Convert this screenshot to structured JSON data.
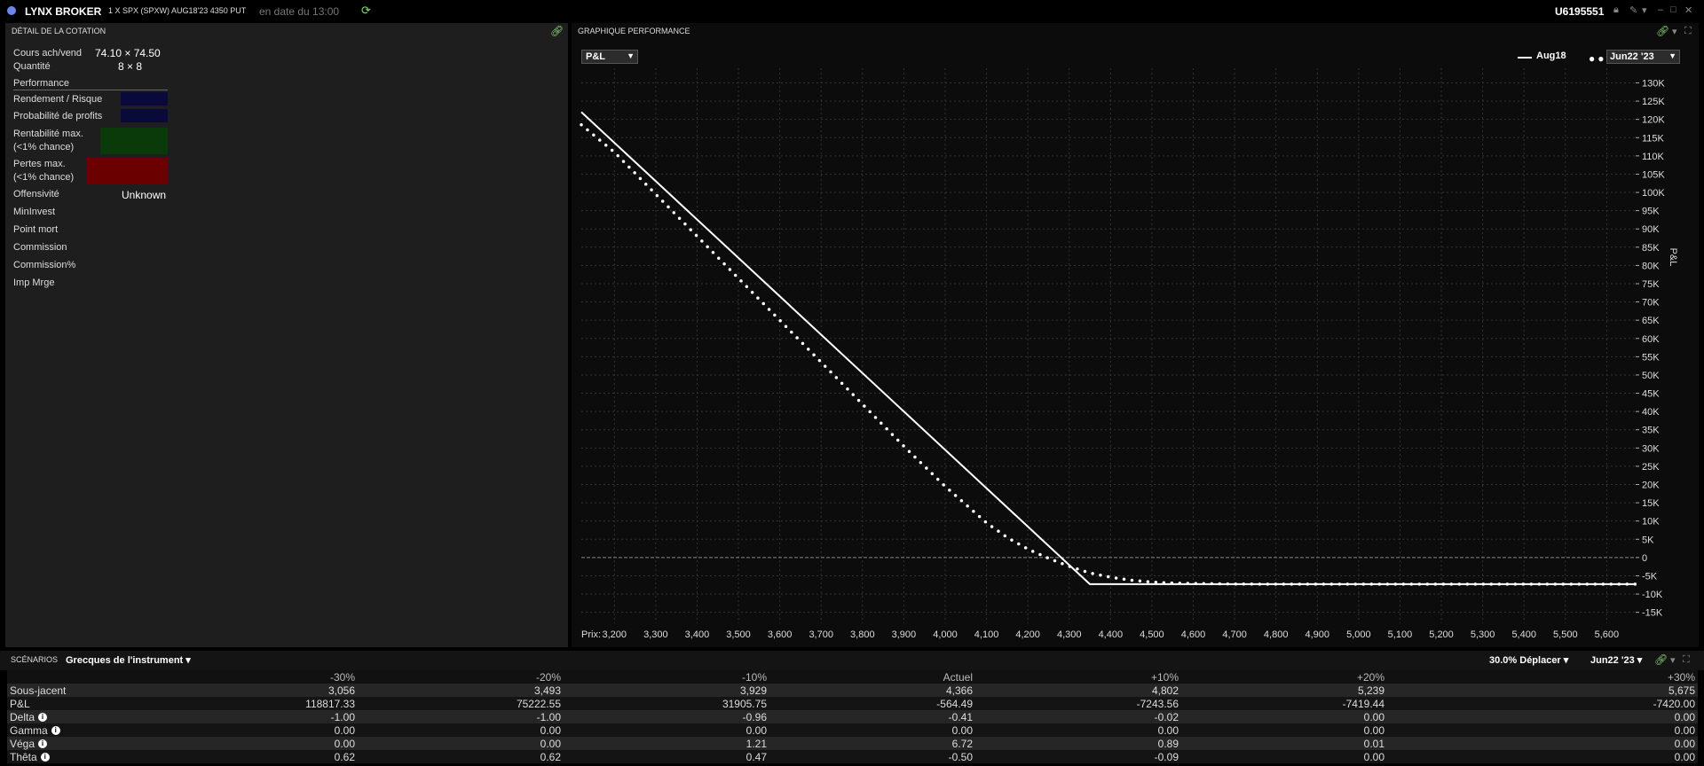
{
  "titlebar": {
    "app_name": "LYNX BROKER",
    "contract": "1 X SPX (SPXW) AUG18'23 4350 PUT",
    "as_of": "en date du 13:00",
    "account": "U6195551"
  },
  "quote_panel": {
    "title": "DÉTAIL DE LA COTATION",
    "bid_ask_label": "Cours ach/vend",
    "bid_ask_value": "74.10 × 74.50",
    "quantity_label": "Quantité",
    "quantity_value": "8 × 8",
    "performance_label": "Performance",
    "rows": [
      {
        "label": "Rendement / Risque"
      },
      {
        "label": "Probabilité de profits"
      },
      {
        "label": "Rentabilité max.",
        "label2": "(<1% chance)"
      },
      {
        "label": "Pertes max.",
        "label2": "(<1% chance)"
      }
    ],
    "offensivite_label": "Offensivité",
    "offensivite_value": "Unknown",
    "other_labels": [
      "MinInvest",
      "Point mort",
      "Commission",
      "Commission%",
      "Imp Mrge"
    ],
    "colors": {
      "blue_box": "#0a0a3a",
      "green_box": "#0a3a0a",
      "red_box": "#6a0000"
    }
  },
  "chart_panel": {
    "title": "GRAPHIQUE PERFORMANCE",
    "metric_select": "P&L",
    "date_select": "Jun22 '23",
    "legend_solid": "Aug18",
    "legend_dots": "Jun22 '23",
    "x_prefix": "Prix:"
  },
  "chart_data": {
    "type": "line",
    "ylabel": "P&L",
    "xlim": [
      3120,
      5670
    ],
    "ylim": [
      -18000,
      134000
    ],
    "x_ticks": [
      3200,
      3300,
      3400,
      3500,
      3600,
      3700,
      3800,
      3900,
      4000,
      4100,
      4200,
      4300,
      4400,
      4500,
      4600,
      4700,
      4800,
      4900,
      5000,
      5100,
      5200,
      5300,
      5400,
      5500,
      5600
    ],
    "x_tick_labels": [
      "3,200",
      "3,300",
      "3,400",
      "3,500",
      "3,600",
      "3,700",
      "3,800",
      "3,900",
      "4,000",
      "4,100",
      "4,200",
      "4,300",
      "4,400",
      "4,500",
      "4,600",
      "4,700",
      "4,800",
      "4,900",
      "5,000",
      "5,100",
      "5,200",
      "5,300",
      "5,400",
      "5,500",
      "5,600"
    ],
    "y_ticks": [
      -15000,
      -10000,
      -5000,
      0,
      5000,
      10000,
      15000,
      20000,
      25000,
      30000,
      35000,
      40000,
      45000,
      50000,
      55000,
      60000,
      65000,
      70000,
      75000,
      80000,
      85000,
      90000,
      95000,
      100000,
      105000,
      110000,
      115000,
      120000,
      125000,
      130000
    ],
    "y_tick_labels": [
      "-15K",
      "-10K",
      "-5K",
      "0",
      "5K",
      "10K",
      "15K",
      "20K",
      "25K",
      "30K",
      "35K",
      "40K",
      "45K",
      "50K",
      "55K",
      "60K",
      "65K",
      "70K",
      "75K",
      "80K",
      "85K",
      "90K",
      "95K",
      "100K",
      "105K",
      "110K",
      "115K",
      "120K",
      "125K",
      "130K"
    ],
    "grid": true,
    "series": [
      {
        "name": "Aug18",
        "style": "solid",
        "x": [
          3120,
          4350,
          5670
        ],
        "y": [
          122000,
          -7300,
          -7300
        ]
      },
      {
        "name": "Jun22 '23",
        "style": "dotted",
        "x": [
          3120,
          3200,
          3300,
          3400,
          3500,
          3600,
          3700,
          3800,
          3900,
          4000,
          4100,
          4150,
          4200,
          4250,
          4300,
          4350,
          4400,
          4450,
          4500,
          4550,
          4600,
          4700,
          4800,
          4900,
          5000,
          5200,
          5400,
          5670
        ],
        "y": [
          118500,
          111000,
          99500,
          88000,
          76500,
          65000,
          53500,
          42000,
          30500,
          19500,
          9500,
          5500,
          2300,
          -200,
          -2400,
          -4200,
          -5400,
          -6200,
          -6700,
          -7000,
          -7100,
          -7250,
          -7300,
          -7300,
          -7300,
          -7300,
          -7300,
          -7300
        ]
      }
    ]
  },
  "scenarios": {
    "title": "SCÉNARIOS",
    "selector": "Grecques de l'instrument",
    "move_select": "30.0% Déplacer",
    "date_select": "Jun22 '23",
    "headers": [
      "-30%",
      "-20%",
      "-10%",
      "Actuel",
      "+10%",
      "+20%",
      "+30%"
    ],
    "rows": [
      {
        "label": "Sous-jacent",
        "values": [
          "3,056",
          "3,493",
          "3,929",
          "4,366",
          "4,802",
          "5,239",
          "5,675"
        ]
      },
      {
        "label": "P&L",
        "values": [
          "118817.33",
          "75222.55",
          "31905.75",
          "-564.49",
          "-7243.56",
          "-7419.44",
          "-7420.00"
        ]
      },
      {
        "label": "Delta",
        "values": [
          "-1.00",
          "-1.00",
          "-0.96",
          "-0.41",
          "-0.02",
          "0.00",
          "0.00"
        ]
      },
      {
        "label": "Gamma",
        "values": [
          "0.00",
          "0.00",
          "0.00",
          "0.00",
          "0.00",
          "0.00",
          "0.00"
        ]
      },
      {
        "label": "Véga",
        "values": [
          "0.00",
          "0.00",
          "1.21",
          "6.72",
          "0.89",
          "0.01",
          "0.00"
        ]
      },
      {
        "label": "Thêta",
        "values": [
          "0.62",
          "0.62",
          "0.47",
          "-0.50",
          "-0.09",
          "0.00",
          "0.00"
        ]
      }
    ]
  }
}
